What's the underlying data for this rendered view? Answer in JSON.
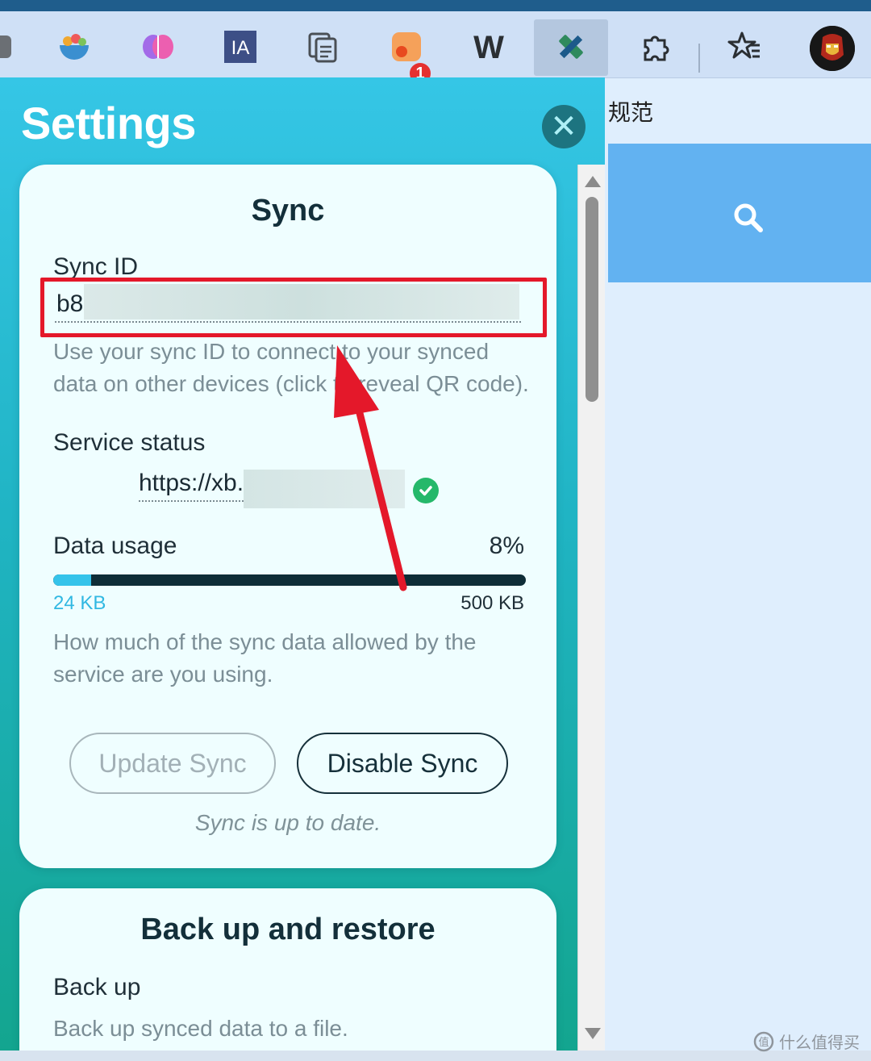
{
  "toolbar": {
    "icons": [
      "broom-extension-icon",
      "bowl-extension-icon",
      "brain-extension-icon",
      "ia-extension-icon",
      "copy-extension-icon",
      "rss-extension-icon",
      "w-extension-icon",
      "satellite-extension-icon",
      "puzzle-extensions-icon",
      "favorites-icon",
      "profile-avatar"
    ],
    "ia_label": "IA",
    "w_label": "W",
    "badge_count": "1"
  },
  "background_page": {
    "partial_text": "规范",
    "watermark": "什么值得买"
  },
  "settings": {
    "title": "Settings",
    "sync": {
      "title": "Sync",
      "sync_id_label": "Sync ID",
      "sync_id_value": "b8",
      "sync_id_help": "Use your sync ID to connect to your synced data on other devices (click to reveal QR code).",
      "service_status_label": "Service status",
      "service_url": "https://xb.",
      "status": "ok",
      "data_usage_label": "Data usage",
      "data_usage_percent": "8%",
      "data_usage_fraction": 0.08,
      "used": "24 KB",
      "limit": "500 KB",
      "data_usage_help": "How much of the sync data allowed by the service are you using.",
      "update_button": "Update Sync",
      "disable_button": "Disable Sync",
      "status_note": "Sync is up to date."
    },
    "backup": {
      "title": "Back up and restore",
      "backup_label": "Back up",
      "backup_help": "Back up synced data to a file."
    }
  },
  "colors": {
    "accent_teal": "#35c6e6",
    "annotation_red": "#e4182a",
    "status_ok": "#25b86a"
  }
}
